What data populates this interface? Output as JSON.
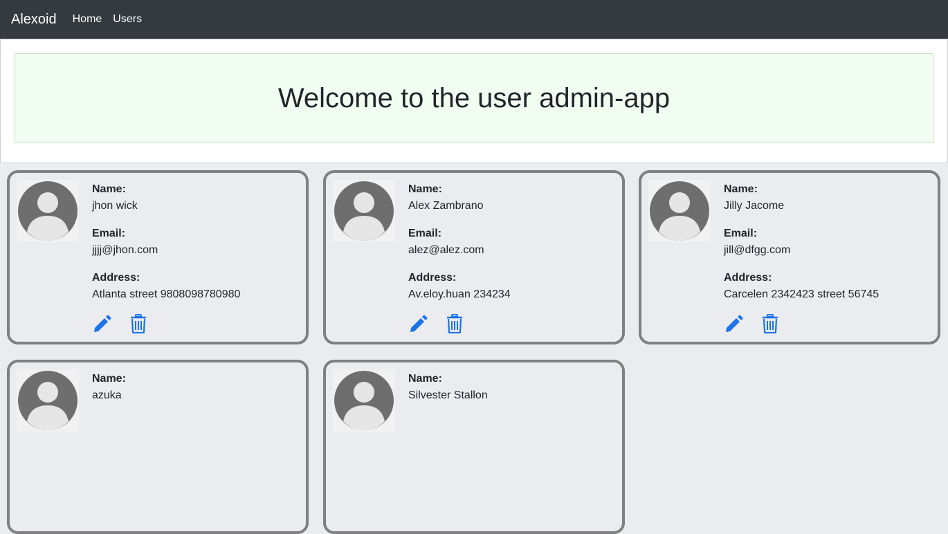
{
  "navbar": {
    "brand": "Alexoid",
    "links": [
      "Home",
      "Users"
    ]
  },
  "hero": {
    "title": "Welcome to the user admin-app"
  },
  "labels": {
    "name": "Name:",
    "email": "Email:",
    "address": "Address:"
  },
  "icons": {
    "edit": "pencil-icon",
    "delete": "trash-icon",
    "avatar": "user-silhouette-icon"
  },
  "colors": {
    "accent": "#1a73e8",
    "navbar": "#343a40",
    "card_border": "#808080"
  },
  "users": [
    {
      "name": "jhon wick",
      "email": "jjjj@jhon.com",
      "address": "Atlanta street 9808098780980"
    },
    {
      "name": "Alex Zambrano",
      "email": "alez@alez.com",
      "address": "Av.eloy.huan 234234"
    },
    {
      "name": "Jilly Jacome",
      "email": "jill@dfgg.com",
      "address": "Carcelen 2342423 street 56745"
    },
    {
      "name": "azuka",
      "email": "",
      "address": ""
    },
    {
      "name": "Silvester Stallon",
      "email": "",
      "address": ""
    }
  ]
}
